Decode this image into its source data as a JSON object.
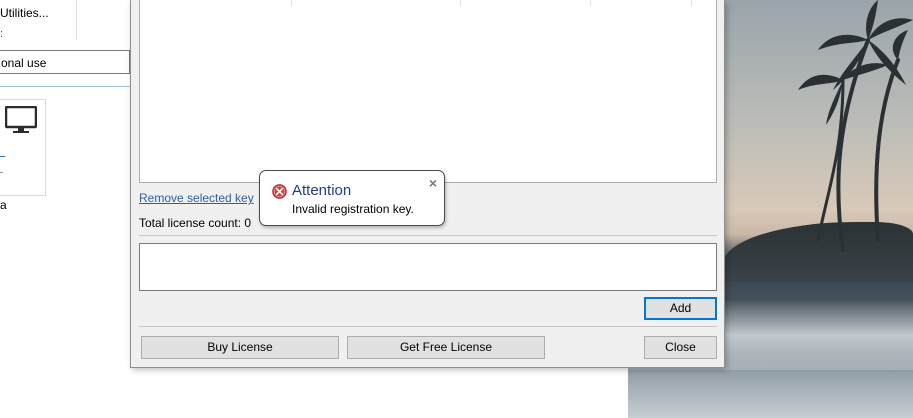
{
  "background_app": {
    "menu_item": "Utilities...",
    "combo_value": "onal use",
    "tile_caption": "a"
  },
  "dialog": {
    "remove_link": "Remove selected key",
    "remove_link_suffix": ".",
    "license_count": "Total license count: 0",
    "key_input_value": "",
    "buttons": {
      "add": "Add",
      "buy": "Buy License",
      "free": "Get Free License",
      "close": "Close"
    }
  },
  "balloon": {
    "title": "Attention",
    "message": "Invalid registration key.",
    "close_glyph": "×",
    "icon": "error-icon"
  },
  "colors": {
    "link": "#2d5fa8",
    "balloon_title": "#1e3d8f",
    "error_icon": "#d9393e",
    "default_button_border": "#0078d7"
  }
}
